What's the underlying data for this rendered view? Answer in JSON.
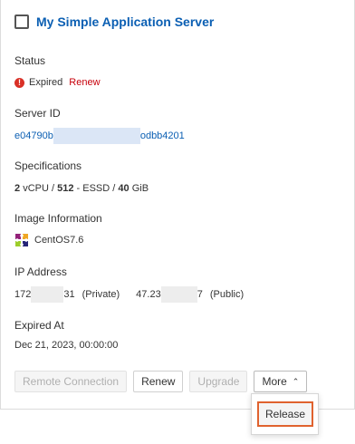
{
  "server": {
    "title": "My Simple Application Server"
  },
  "status": {
    "label": "Status",
    "value": "Expired",
    "renew_link": "Renew",
    "color": "#d93026"
  },
  "server_id": {
    "label": "Server ID",
    "prefix": "e04790b",
    "suffix": "odbb4201"
  },
  "specifications": {
    "label": "Specifications",
    "cpu_count": "2",
    "cpu_unit": "vCPU",
    "sep1": "/",
    "memory": "512",
    "sep2": "- ESSD /",
    "disk": "40",
    "disk_unit": "GiB"
  },
  "image": {
    "label": "Image Information",
    "name": "CentOS7.6",
    "icon": "centos-icon"
  },
  "ip": {
    "label": "IP Address",
    "private_prefix": "172",
    "private_suffix": "31",
    "private_tag": "(Private)",
    "public_prefix": "47.23",
    "public_suffix": "7",
    "public_tag": "(Public)"
  },
  "expired_at": {
    "label": "Expired At",
    "value": "Dec 21, 2023, 00:00:00"
  },
  "actions": {
    "remote": "Remote Connection",
    "renew": "Renew",
    "upgrade": "Upgrade",
    "more": "More"
  },
  "dropdown": {
    "release": "Release",
    "highlight_color": "#e0622e"
  }
}
